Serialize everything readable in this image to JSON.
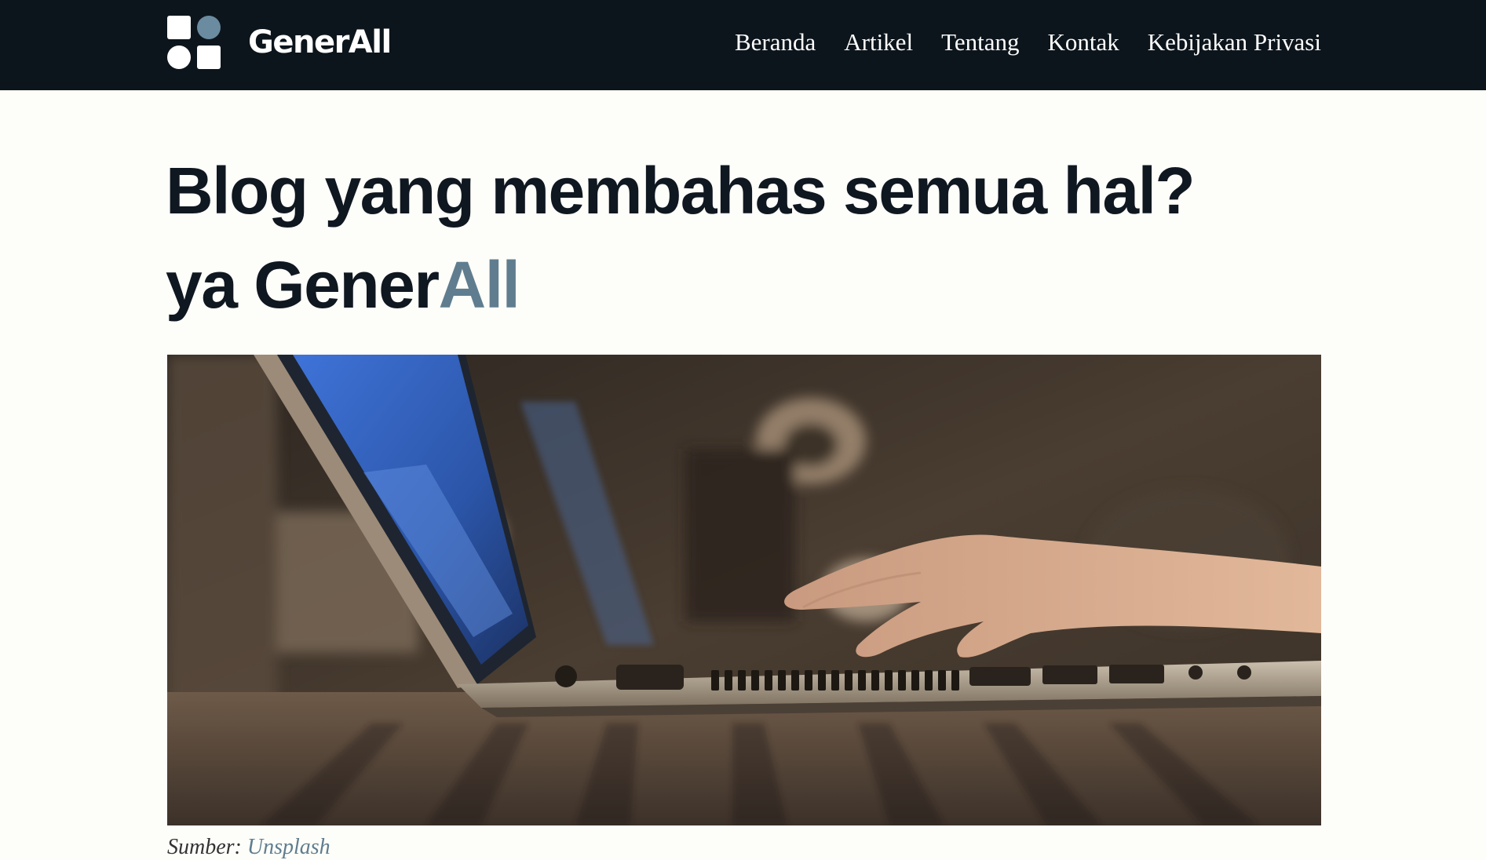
{
  "header": {
    "brand": "GenerAll",
    "nav": [
      {
        "label": "Beranda"
      },
      {
        "label": "Artikel"
      },
      {
        "label": "Tentang"
      },
      {
        "label": "Kontak"
      },
      {
        "label": "Kebijakan Privasi"
      }
    ]
  },
  "hero": {
    "title_line1": "Blog yang membahas semua hal?",
    "title_line2_prefix": "ya Gener",
    "title_line2_accent": "All"
  },
  "image": {
    "alt": "Laptop with hand typing on keyboard"
  },
  "caption": {
    "prefix": "Sumber: ",
    "link_text": "Unsplash"
  },
  "colors": {
    "header_bg": "#0d151c",
    "accent": "#607d8f",
    "page_bg": "#fdfdf9",
    "text": "#0f1720"
  }
}
